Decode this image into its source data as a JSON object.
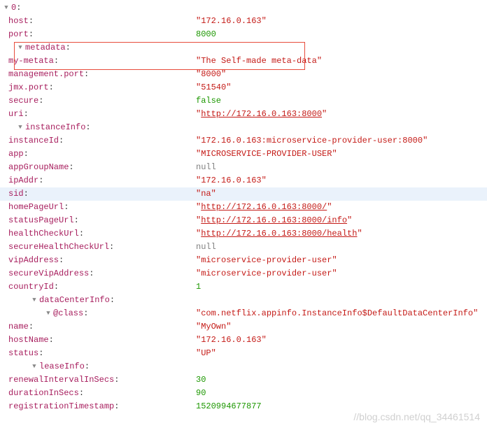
{
  "root": {
    "index": "0",
    "host": "172.16.0.163",
    "port": 8000,
    "metadata": {
      "my_metata_key": "my-metata",
      "my_metata_val": "The Self-made meta-data"
    },
    "management_port_key": "management.port",
    "management_port_val": "8000",
    "jmx_port_key": "jmx.port",
    "jmx_port_val": "51540",
    "secure": "false",
    "uri": "http://172.16.0.163:8000",
    "instanceInfo": {
      "instanceId": "172.16.0.163:microservice-provider-user:8000",
      "app": "MICROSERVICE-PROVIDER-USER",
      "appGroupName": "null",
      "ipAddr": "172.16.0.163",
      "sid": "na",
      "homePageUrl": "http://172.16.0.163:8000/",
      "statusPageUrl": "http://172.16.0.163:8000/info",
      "healthCheckUrl": "http://172.16.0.163:8000/health",
      "secureHealthCheckUrl": "null",
      "vipAddress": "microservice-provider-user",
      "secureVipAddress": "microservice-provider-user",
      "countryId": 1,
      "dataCenterInfo": {
        "class_key": "@class",
        "class_val": "com.netflix.appinfo.InstanceInfo$DefaultDataCenterInfo",
        "name": "MyOwn"
      },
      "hostName": "172.16.0.163",
      "status": "UP",
      "leaseInfo": {
        "renewalIntervalInSecs": 30,
        "durationInSecs": 90,
        "registrationTimestamp": 1520994677877
      }
    }
  },
  "labels": {
    "host": "host",
    "port": "port",
    "metadata": "metadata",
    "secure": "secure",
    "uri": "uri",
    "instanceInfo": "instanceInfo",
    "instanceId": "instanceId",
    "app": "app",
    "appGroupName": "appGroupName",
    "ipAddr": "ipAddr",
    "sid": "sid",
    "homePageUrl": "homePageUrl",
    "statusPageUrl": "statusPageUrl",
    "healthCheckUrl": "healthCheckUrl",
    "secureHealthCheckUrl": "secureHealthCheckUrl",
    "vipAddress": "vipAddress",
    "secureVipAddress": "secureVipAddress",
    "countryId": "countryId",
    "dataCenterInfo": "dataCenterInfo",
    "name": "name",
    "hostName": "hostName",
    "status": "status",
    "leaseInfo": "leaseInfo",
    "renewalIntervalInSecs": "renewalIntervalInSecs",
    "durationInSecs": "durationInSecs",
    "registrationTimestamp": "registrationTimestamp"
  },
  "watermark": "//blog.csdn.net/qq_34461514"
}
